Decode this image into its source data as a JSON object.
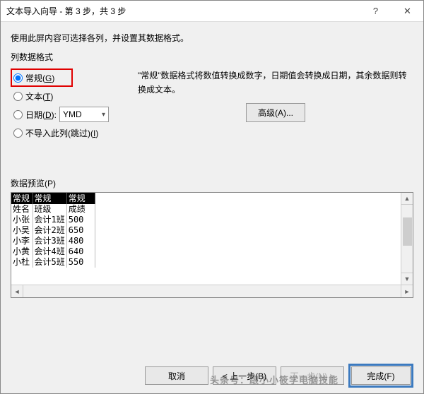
{
  "titlebar": {
    "title": "文本导入向导 - 第 3 步，共 3 步"
  },
  "intro": "使用此屏内容可选择各列，并设置其数据格式。",
  "format": {
    "legend": "列数据格式",
    "general": {
      "label_pre": "常规(",
      "label_u": "G",
      "label_post": ")"
    },
    "text": {
      "label_pre": "文本(",
      "label_u": "T",
      "label_post": ")"
    },
    "date": {
      "label_pre": "日期(",
      "label_u": "D",
      "label_post": "):",
      "value": "YMD"
    },
    "skip": {
      "label_pre": "不导入此列(跳过)(",
      "label_u": "I",
      "label_post": ")"
    },
    "description": "\"常规\"数据格式将数值转换成数字，日期值会转换成日期，其余数据则转换成文本。",
    "advanced_label": "高级(A)..."
  },
  "preview": {
    "legend": "数据预览(P)",
    "headers": [
      "常规",
      "常规",
      "常规"
    ],
    "rows": [
      [
        "姓名",
        "班级",
        "成绩"
      ],
      [
        "小张",
        "会计1班",
        "500"
      ],
      [
        "小吴",
        "会计2班",
        "650"
      ],
      [
        "小李",
        "会计3班",
        "480"
      ],
      [
        "小黄",
        "会计4班",
        "640"
      ],
      [
        "小杜",
        "会计5班",
        "550"
      ]
    ]
  },
  "footer": {
    "cancel": "取消",
    "back": "< 上一步(B)",
    "next": "下一步(N) >",
    "finish": "完成(F)"
  },
  "watermark": "头条号：跟小小筱学电脑技能"
}
